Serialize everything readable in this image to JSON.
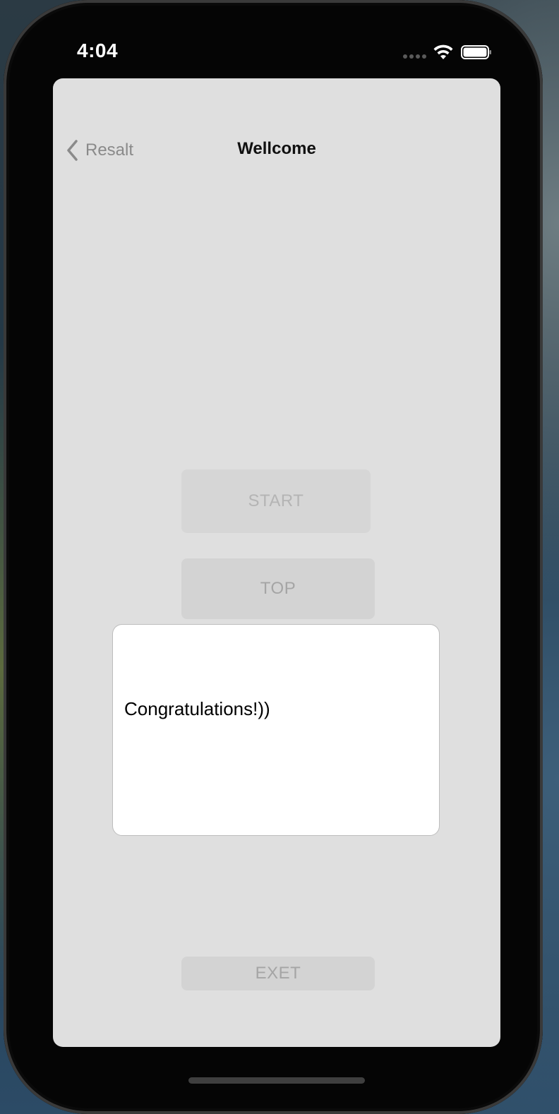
{
  "status_bar": {
    "time": "4:04"
  },
  "nav": {
    "back_label": "Resalt",
    "title": "Wellcome"
  },
  "buttons": {
    "start": "START",
    "top": "TOP",
    "exit": "EXET"
  },
  "dialog": {
    "message": "Congratulations!))"
  },
  "icons": {
    "back": "chevron-back-icon",
    "wifi": "wifi-icon",
    "battery": "battery-icon",
    "signal": "signal-dots-icon"
  },
  "colors": {
    "sheet_background": "#dfdfdf",
    "button_background": "#d3d3d3",
    "button_text": "#a5a5a5",
    "dialog_background": "#ffffff",
    "phone_frame": "#050505"
  }
}
